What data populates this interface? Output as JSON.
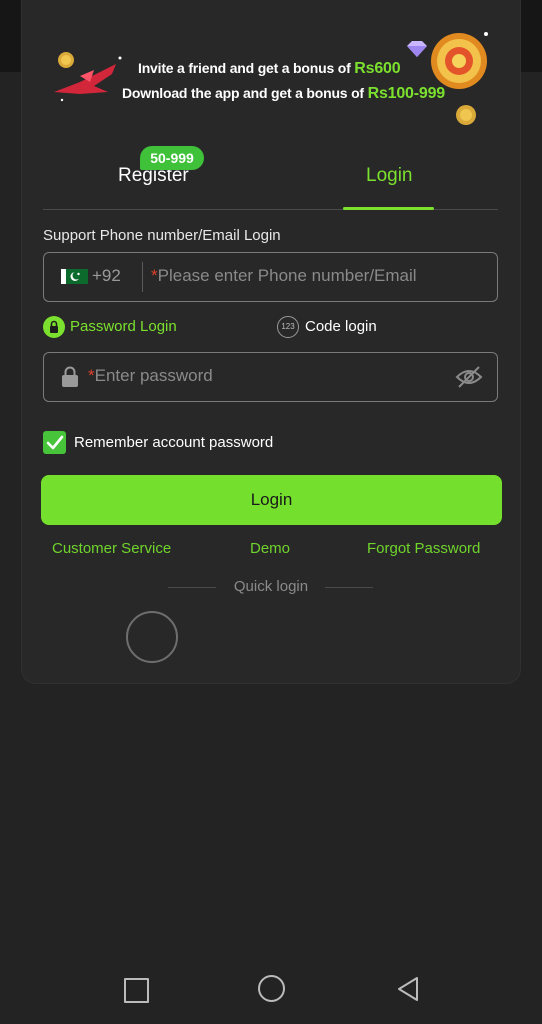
{
  "banner": {
    "invite_text": "Invite a friend and get a bonus of",
    "invite_bonus": "Rs600",
    "download_text": "Download the app and get a bonus of",
    "download_bonus": "Rs100-999"
  },
  "tabs": {
    "register": "Register",
    "register_badge": "50-999",
    "login": "Login",
    "active": "login"
  },
  "form": {
    "label": "Support Phone number/Email Login",
    "country_code": "+92",
    "phone_required_mark": "*",
    "phone_placeholder": "Please enter Phone number/Email",
    "password_login": "Password Login",
    "code_icon_text": "123",
    "code_login": "Code login",
    "password_required_mark": "*",
    "password_placeholder": "Enter password",
    "remember_label": "Remember account password",
    "remember_checked": true,
    "login_button": "Login"
  },
  "links": {
    "customer_service": "Customer Service",
    "demo": "Demo",
    "forgot_password": "Forgot Password"
  },
  "quick_login": "Quick login",
  "colors": {
    "accent": "#74df2c",
    "background": "#232323",
    "card": "#282828",
    "required": "#e0402a"
  },
  "icons": [
    "plane-icon",
    "coin-icon",
    "diamond-icon",
    "treasure-icon",
    "pakistan-flag-icon",
    "lock-icon",
    "eye-off-icon",
    "check-icon",
    "recent-apps-icon",
    "home-icon",
    "back-icon"
  ]
}
